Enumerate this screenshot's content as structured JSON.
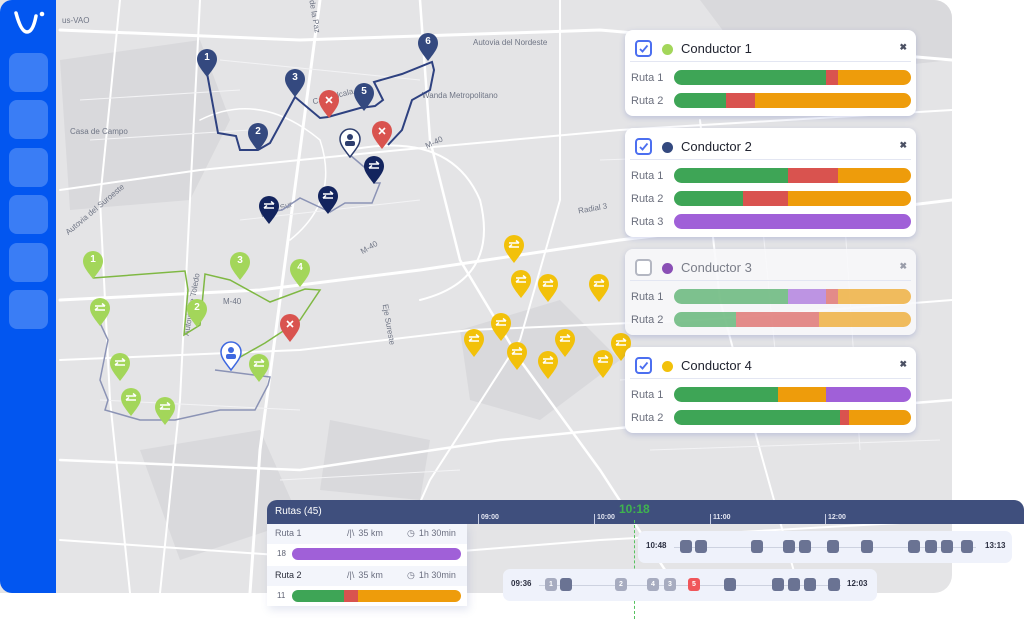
{
  "sidebar": {
    "logo": "V-logo",
    "buttons": [
      "nav-1",
      "nav-2",
      "nav-3",
      "nav-4",
      "nav-5",
      "nav-6"
    ]
  },
  "map": {
    "labels": {
      "top_left_road": "us-VAO",
      "casa_de_campo": "Casa de Campo",
      "autovia_nordeste": "Autovia del Nordeste",
      "wanda": "Wanda Metropolitano",
      "m40_north": "M-40",
      "m40_mid": "M-40",
      "m40_south": "M-40",
      "radial3": "Radial 3",
      "autovia_suroeste": "Autovia del Suroeste",
      "autovia_toledo": "Autovia de Toledo",
      "de_la_paz": "de la Paz",
      "calle_alcala": "Calle Alcala",
      "eje_sureste": "Eje Sureste",
      "m30_sur": "M-30 Sur"
    },
    "colors": {
      "driver1": "#a3d65a",
      "driver2": "#34497f",
      "driver2_transfer": "#13245e",
      "driver4": "#f2c10a",
      "incident": "#d9534f"
    },
    "driver2_stops": [
      "1",
      "2",
      "3",
      "5",
      "6"
    ],
    "driver1_stops": [
      "1",
      "2",
      "3",
      "4"
    ]
  },
  "drivers": [
    {
      "name": "Conductor 1",
      "checked": true,
      "color": "#a3d65a",
      "routes": [
        {
          "label": "Ruta 1",
          "segments": [
            {
              "color": "#3ea556",
              "pct": 64
            },
            {
              "color": "#d9534f",
              "pct": 5
            },
            {
              "color": "#ee9c0b",
              "pct": 31
            }
          ]
        },
        {
          "label": "Ruta 2",
          "segments": [
            {
              "color": "#3ea556",
              "pct": 22
            },
            {
              "color": "#d9534f",
              "pct": 12
            },
            {
              "color": "#ee9c0b",
              "pct": 66
            }
          ]
        }
      ]
    },
    {
      "name": "Conductor 2",
      "checked": true,
      "color": "#34497f",
      "routes": [
        {
          "label": "Ruta 1",
          "segments": [
            {
              "color": "#3ea556",
              "pct": 48
            },
            {
              "color": "#d9534f",
              "pct": 21
            },
            {
              "color": "#ee9c0b",
              "pct": 31
            }
          ]
        },
        {
          "label": "Ruta 2",
          "segments": [
            {
              "color": "#3ea556",
              "pct": 29
            },
            {
              "color": "#d9534f",
              "pct": 19
            },
            {
              "color": "#ee9c0b",
              "pct": 52
            }
          ]
        },
        {
          "label": "Ruta 3",
          "segments": [
            {
              "color": "#a060d8",
              "pct": 100
            }
          ]
        }
      ]
    },
    {
      "name": "Conductor 3",
      "checked": false,
      "color": "#8a4fb5",
      "routes": [
        {
          "label": "Ruta 1",
          "segments": [
            {
              "color": "#3ea556",
              "pct": 48
            },
            {
              "color": "#a060d8",
              "pct": 16
            },
            {
              "color": "#d9534f",
              "pct": 5
            },
            {
              "color": "#ee9c0b",
              "pct": 31
            }
          ]
        },
        {
          "label": "Ruta 2",
          "segments": [
            {
              "color": "#3ea556",
              "pct": 26
            },
            {
              "color": "#d9534f",
              "pct": 35
            },
            {
              "color": "#ee9c0b",
              "pct": 39
            }
          ]
        }
      ]
    },
    {
      "name": "Conductor 4",
      "checked": true,
      "color": "#f2c10a",
      "routes": [
        {
          "label": "Ruta 1",
          "segments": [
            {
              "color": "#3ea556",
              "pct": 44
            },
            {
              "color": "#ee9c0b",
              "pct": 20
            },
            {
              "color": "#a060d8",
              "pct": 36
            }
          ]
        },
        {
          "label": "Ruta 2",
          "segments": [
            {
              "color": "#3ea556",
              "pct": 70
            },
            {
              "color": "#d9534f",
              "pct": 4
            },
            {
              "color": "#ee9c0b",
              "pct": 26
            }
          ]
        }
      ]
    }
  ],
  "timeline": {
    "title": "Rutas (45)",
    "ticks": [
      "09:00",
      "10:00",
      "11:00",
      "12:00"
    ],
    "now": "10:18",
    "routes": [
      {
        "name": "Ruta 1",
        "distance": "35 km",
        "duration": "1h 30min",
        "count": "18",
        "segments": [
          {
            "color": "#a060d8",
            "pct": 100
          }
        ]
      },
      {
        "name": "Ruta 2",
        "distance": "35 km",
        "duration": "1h 30min",
        "count": "11",
        "segments": [
          {
            "color": "#3ea556",
            "pct": 31
          },
          {
            "color": "#d9534f",
            "pct": 8
          },
          {
            "color": "#ee9c0b",
            "pct": 61
          }
        ]
      }
    ],
    "lanes": [
      {
        "start": "10:48",
        "end": "13:13",
        "stops": [
          "",
          "",
          "",
          "",
          "",
          "",
          "",
          "",
          "",
          "",
          ""
        ]
      },
      {
        "start": "09:36",
        "end": "12:03",
        "stops": [
          "1",
          "",
          "2",
          "4",
          "3",
          "5",
          "",
          "",
          "",
          "",
          ""
        ]
      }
    ]
  }
}
